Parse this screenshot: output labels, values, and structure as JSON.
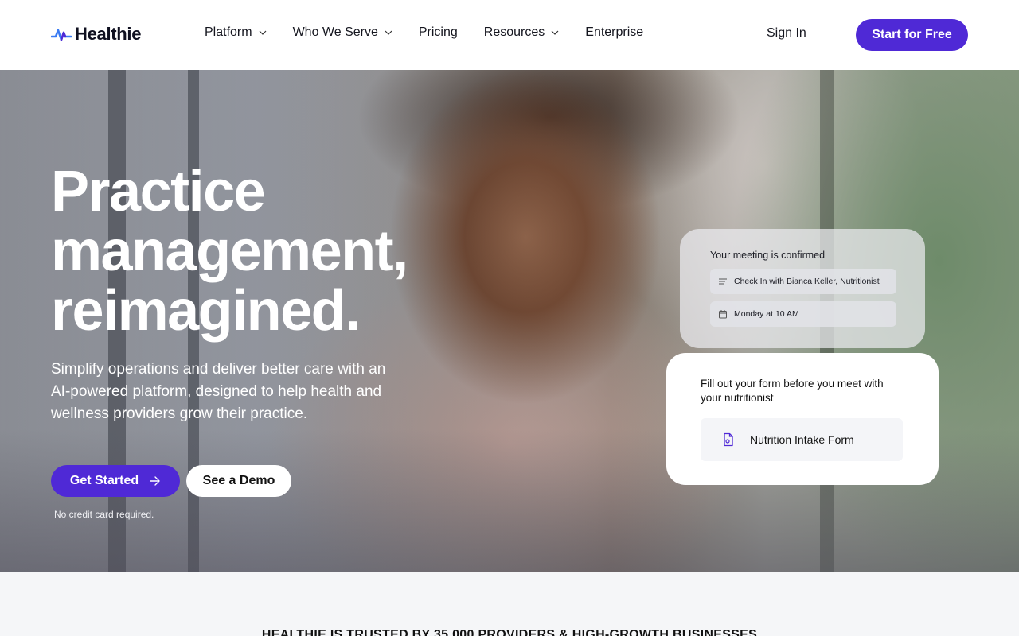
{
  "brand": {
    "name": "Healthie",
    "logo_icon": "pulse-wave-icon",
    "accent": "#4f29d6"
  },
  "nav": {
    "items": [
      {
        "label": "Platform",
        "has_dropdown": true
      },
      {
        "label": "Who We Serve",
        "has_dropdown": true
      },
      {
        "label": "Pricing",
        "has_dropdown": false
      },
      {
        "label": "Resources",
        "has_dropdown": true
      },
      {
        "label": "Enterprise",
        "has_dropdown": false
      }
    ],
    "sign_in": "Sign In",
    "cta": "Start for Free"
  },
  "hero": {
    "title_lines": [
      "Practice",
      "management,",
      "reimagined."
    ],
    "subtitle": "Simplify operations and deliver better care with an AI-powered platform, designed to help health and wellness providers grow their practice.",
    "primary_button": "Get Started",
    "secondary_button": "See a Demo",
    "note": "No credit card required."
  },
  "meeting_card": {
    "title": "Your meeting is confirmed",
    "rows": [
      {
        "icon": "text-lines-icon",
        "text": "Check In with Bianca Keller, Nutritionist"
      },
      {
        "icon": "calendar-icon",
        "text": "Monday at 10 AM"
      }
    ]
  },
  "form_card": {
    "title": "Fill out your form before you meet with your nutritionist",
    "item": {
      "icon": "document-icon",
      "label": "Nutrition Intake Form"
    }
  },
  "trusted": {
    "text": "HEALTHIE IS TRUSTED BY 35,000 PROVIDERS & HIGH-GROWTH BUSINESSES"
  }
}
